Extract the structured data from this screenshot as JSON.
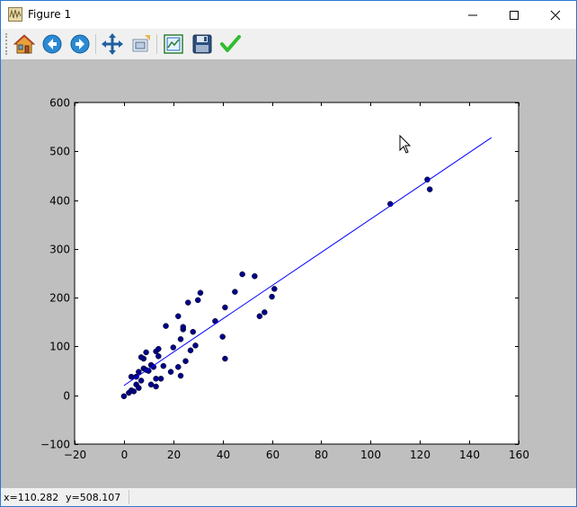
{
  "window": {
    "title": "Figure 1",
    "buttons": {
      "minimize": "minimize",
      "maximize": "maximize",
      "close": "close"
    }
  },
  "toolbar": {
    "items": [
      {
        "name": "home-button",
        "icon": "home-icon",
        "tooltip": "Home"
      },
      {
        "name": "back-button",
        "icon": "back-arrow-icon",
        "tooltip": "Back"
      },
      {
        "name": "forward-button",
        "icon": "forward-arrow-icon",
        "tooltip": "Forward"
      },
      {
        "name": "pan-button",
        "icon": "pan-move-icon",
        "tooltip": "Pan"
      },
      {
        "name": "zoom-button",
        "icon": "zoom-rect-icon",
        "tooltip": "Zoom"
      },
      {
        "name": "subplots-button",
        "icon": "configure-subplots-icon",
        "tooltip": "Subplots"
      },
      {
        "name": "save-button",
        "icon": "floppy-disk-icon",
        "tooltip": "Save"
      },
      {
        "name": "edit-button",
        "icon": "checkmark-icon",
        "tooltip": "Edit"
      }
    ]
  },
  "status": {
    "x_readout": "x=110.282",
    "y_readout": "y=508.107"
  },
  "colors": {
    "canvas_bg": "#bfbfbf",
    "plot_bg": "#ffffff",
    "point_color": "#00008b",
    "line_color": "#0000ff"
  },
  "chart_data": {
    "type": "scatter",
    "xlim": [
      -20,
      160
    ],
    "ylim": [
      -100,
      600
    ],
    "x_ticks": [
      -20,
      0,
      20,
      40,
      60,
      80,
      100,
      120,
      140,
      160
    ],
    "y_ticks": [
      -100,
      0,
      100,
      200,
      300,
      400,
      500,
      600
    ],
    "x_tick_labels": [
      "−20",
      "0",
      "20",
      "40",
      "60",
      "80",
      "100",
      "120",
      "140",
      "160"
    ],
    "y_tick_labels": [
      "−100",
      "0",
      "100",
      "200",
      "300",
      "400",
      "500",
      "600"
    ],
    "grid": false,
    "title": "",
    "xlabel": "",
    "ylabel": "",
    "series": [
      {
        "kind": "points",
        "points": [
          [
            0,
            -2
          ],
          [
            2,
            5
          ],
          [
            3,
            10
          ],
          [
            4,
            8
          ],
          [
            3,
            38
          ],
          [
            5,
            38
          ],
          [
            5,
            22
          ],
          [
            6,
            15
          ],
          [
            6,
            48
          ],
          [
            7,
            30
          ],
          [
            8,
            75
          ],
          [
            7,
            78
          ],
          [
            8,
            55
          ],
          [
            9,
            52
          ],
          [
            9,
            88
          ],
          [
            10,
            50
          ],
          [
            11,
            62
          ],
          [
            11,
            22
          ],
          [
            12,
            58
          ],
          [
            13,
            90
          ],
          [
            14,
            95
          ],
          [
            13,
            34
          ],
          [
            13,
            18
          ],
          [
            14,
            80
          ],
          [
            15,
            34
          ],
          [
            16,
            60
          ],
          [
            17,
            142
          ],
          [
            19,
            48
          ],
          [
            20,
            98
          ],
          [
            22,
            162
          ],
          [
            23,
            115
          ],
          [
            22,
            58
          ],
          [
            23,
            40
          ],
          [
            24,
            135
          ],
          [
            24,
            140
          ],
          [
            25,
            70
          ],
          [
            26,
            190
          ],
          [
            27,
            92
          ],
          [
            28,
            130
          ],
          [
            29,
            102
          ],
          [
            30,
            195
          ],
          [
            31,
            210
          ],
          [
            37,
            152
          ],
          [
            40,
            120
          ],
          [
            41,
            180
          ],
          [
            41,
            75
          ],
          [
            45,
            212
          ],
          [
            48,
            248
          ],
          [
            53,
            244
          ],
          [
            55,
            162
          ],
          [
            57,
            170
          ],
          [
            60,
            202
          ],
          [
            61,
            218
          ],
          [
            108,
            392
          ],
          [
            123,
            442
          ],
          [
            124,
            422
          ]
        ]
      },
      {
        "kind": "line",
        "points": [
          [
            0,
            20
          ],
          [
            149,
            528
          ]
        ]
      }
    ]
  }
}
